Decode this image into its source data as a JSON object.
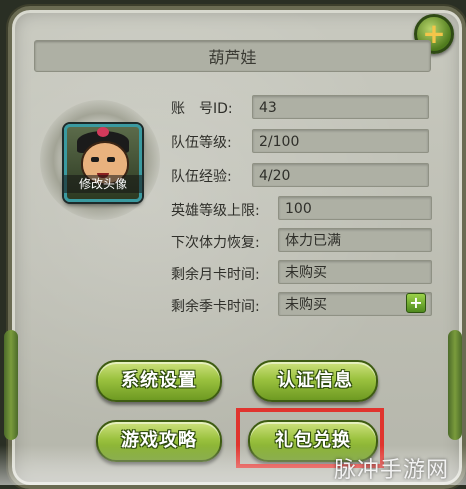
{
  "title": "葫芦娃",
  "avatar": {
    "label": "修改头像"
  },
  "info_rows": [
    {
      "label": "账　号ID:",
      "value": "43"
    },
    {
      "label": "队伍等级:",
      "value": "2/100"
    },
    {
      "label": "队伍经验:",
      "value": "4/20"
    },
    {
      "label": "英雄等级上限:",
      "value": "100"
    },
    {
      "label": "下次体力恢复:",
      "value": "体力已满"
    },
    {
      "label": "剩余月卡时间:",
      "value": "未购买"
    },
    {
      "label": "剩余季卡时间:",
      "value": "未购买"
    }
  ],
  "buttons": {
    "system_settings": "系统设置",
    "verify_info": "认证信息",
    "game_guide": "游戏攻略",
    "gift_redeem": "礼包兑换"
  },
  "icons": {
    "close": "close-plus-icon",
    "add_season_card": "add-icon"
  },
  "watermark": "脉冲手游网",
  "colors": {
    "button_green": "#9bc23f",
    "highlight_red": "#e0342e",
    "close_gold": "#f3c54a"
  }
}
